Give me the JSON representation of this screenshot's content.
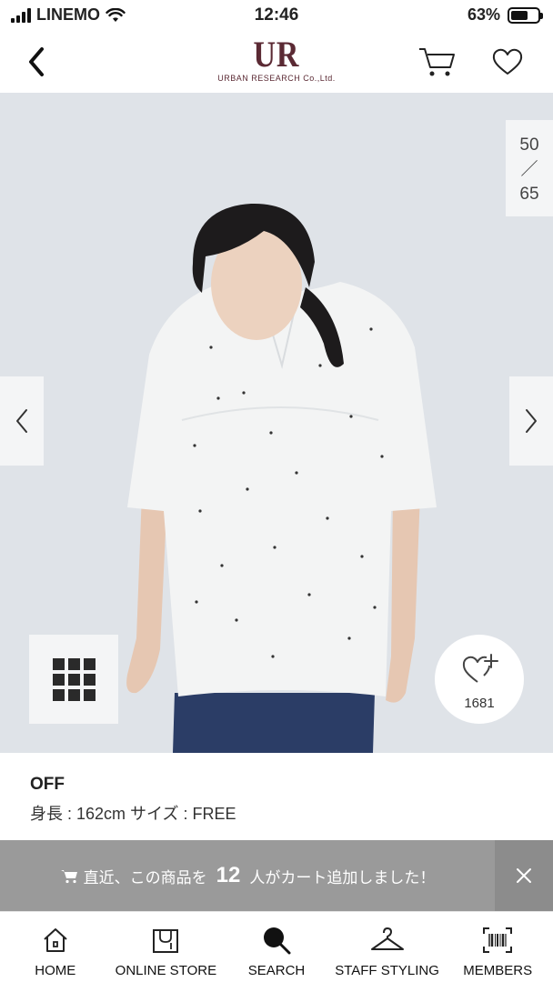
{
  "status_bar": {
    "carrier": "LINEMO",
    "time": "12:46",
    "battery": "63%",
    "battery_level": 0.63
  },
  "header": {
    "logo_mark": "UR",
    "logo_text": "URBAN RESEARCH Co.,Ltd.",
    "icons": [
      "back-icon",
      "cart-icon",
      "heart-icon"
    ]
  },
  "gallery": {
    "current": "50",
    "separator": "／",
    "total": "65",
    "like_count": "1681",
    "icons": [
      "chevron-left-icon",
      "chevron-right-icon",
      "grid-icon",
      "heart-plus-icon"
    ]
  },
  "model_info": {
    "color": "OFF",
    "details": "身長 : 162cm サイズ : FREE"
  },
  "notice": {
    "prefix": "直近、この商品を",
    "count": "12",
    "suffix": "人がカート追加しました！",
    "icons": [
      "cart-small-icon",
      "close-icon"
    ]
  },
  "bottom_nav": {
    "items": [
      {
        "label": "HOME",
        "icon": "home-icon"
      },
      {
        "label": "ONLINE STORE",
        "icon": "shopping-bag-icon"
      },
      {
        "label": "SEARCH",
        "icon": "search-icon"
      },
      {
        "label": "STAFF STYLING",
        "icon": "hanger-icon"
      },
      {
        "label": "MEMBERS",
        "icon": "barcode-icon"
      }
    ]
  },
  "colors": {
    "brand": "#5b2a34",
    "hero_bg": "#dfe3e8",
    "notice_bg": "#9a9a9a"
  }
}
